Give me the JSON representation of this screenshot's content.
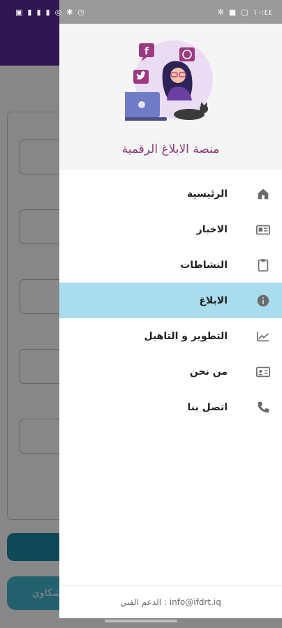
{
  "status_bar": {
    "time": "١٠:٤٤",
    "left_icons": [
      "sim-icon",
      "signal-icon",
      "signal-icon",
      "signal-icon",
      "hotspot-icon",
      "bluetooth-icon",
      "alarm-icon"
    ],
    "right_icons": [
      "wifi-icon",
      "app-icon",
      "image-icon"
    ]
  },
  "background": {
    "button_text": "شكاوي"
  },
  "drawer": {
    "title": "منصة الابلاغ الرقمية",
    "menu": [
      {
        "label": "الرئيسية",
        "icon": "home-icon",
        "active": false
      },
      {
        "label": "الاخبار",
        "icon": "newspaper-icon",
        "active": false
      },
      {
        "label": "النشاطات",
        "icon": "clipboard-icon",
        "active": false
      },
      {
        "label": "الابلاغ",
        "icon": "info-icon",
        "active": true
      },
      {
        "label": "التطوير و التاهيل",
        "icon": "trending-icon",
        "active": false
      },
      {
        "label": "من نحن",
        "icon": "contact-card-icon",
        "active": false
      },
      {
        "label": "اتصل بنا",
        "icon": "phone-icon",
        "active": false
      }
    ],
    "footer_text": "الدعم الفني : info@ifdrt.iq"
  },
  "colors": {
    "app_bar": "#5b2c9c",
    "active_item": "#a9dcec",
    "title": "#8a3f7c",
    "primary_button": "#1e8aa6"
  }
}
